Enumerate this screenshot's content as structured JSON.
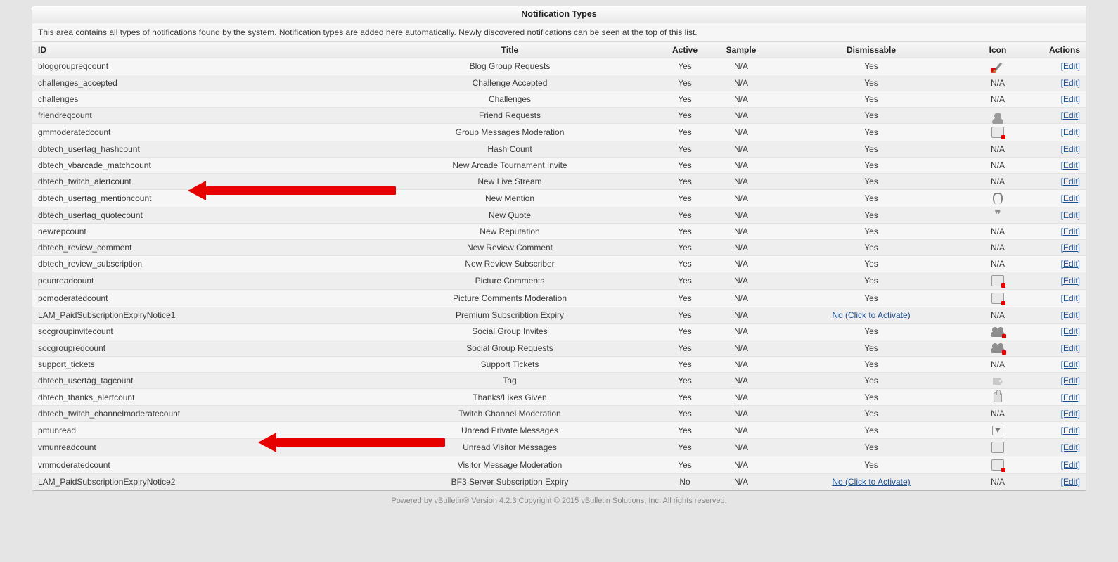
{
  "panel_title": "Notification Types",
  "description": "This area contains all types of notifications found by the system. Notification types are added here automatically. Newly discovered notifications can be seen at the top of this list.",
  "columns": {
    "id": "ID",
    "title": "Title",
    "active": "Active",
    "sample": "Sample",
    "dismissable": "Dismissable",
    "icon": "Icon",
    "actions": "Actions"
  },
  "edit_label": "[Edit]",
  "click_activate": "No (Click to Activate)",
  "footer": "Powered by vBulletin® Version 4.2.3 Copyright © 2015 vBulletin Solutions, Inc. All rights reserved.",
  "rows": [
    {
      "id": "bloggroupreqcount",
      "title": "Blog Group Requests",
      "active": "Yes",
      "sample": "N/A",
      "dismissable": "Yes",
      "icon": "pencil-red",
      "dismiss_link": false
    },
    {
      "id": "challenges_accepted",
      "title": "Challenge Accepted",
      "active": "Yes",
      "sample": "N/A",
      "dismissable": "Yes",
      "icon": "na",
      "dismiss_link": false
    },
    {
      "id": "challenges",
      "title": "Challenges",
      "active": "Yes",
      "sample": "N/A",
      "dismissable": "Yes",
      "icon": "na",
      "dismiss_link": false
    },
    {
      "id": "friendreqcount",
      "title": "Friend Requests",
      "active": "Yes",
      "sample": "N/A",
      "dismissable": "Yes",
      "icon": "person",
      "dismiss_link": false
    },
    {
      "id": "gmmoderatedcount",
      "title": "Group Messages Moderation",
      "active": "Yes",
      "sample": "N/A",
      "dismissable": "Yes",
      "icon": "box-red",
      "dismiss_link": false
    },
    {
      "id": "dbtech_usertag_hashcount",
      "title": "Hash Count",
      "active": "Yes",
      "sample": "N/A",
      "dismissable": "Yes",
      "icon": "na",
      "dismiss_link": false
    },
    {
      "id": "dbtech_vbarcade_matchcount",
      "title": "New Arcade Tournament Invite",
      "active": "Yes",
      "sample": "N/A",
      "dismissable": "Yes",
      "icon": "na",
      "dismiss_link": false
    },
    {
      "id": "dbtech_twitch_alertcount",
      "title": "New Live Stream",
      "active": "Yes",
      "sample": "N/A",
      "dismissable": "Yes",
      "icon": "na",
      "dismiss_link": false
    },
    {
      "id": "dbtech_usertag_mentioncount",
      "title": "New Mention",
      "active": "Yes",
      "sample": "N/A",
      "dismissable": "Yes",
      "icon": "clip",
      "dismiss_link": false
    },
    {
      "id": "dbtech_usertag_quotecount",
      "title": "New Quote",
      "active": "Yes",
      "sample": "N/A",
      "dismissable": "Yes",
      "icon": "quotes",
      "dismiss_link": false
    },
    {
      "id": "newrepcount",
      "title": "New Reputation",
      "active": "Yes",
      "sample": "N/A",
      "dismissable": "Yes",
      "icon": "na",
      "dismiss_link": false
    },
    {
      "id": "dbtech_review_comment",
      "title": "New Review Comment",
      "active": "Yes",
      "sample": "N/A",
      "dismissable": "Yes",
      "icon": "na",
      "dismiss_link": false
    },
    {
      "id": "dbtech_review_subscription",
      "title": "New Review Subscriber",
      "active": "Yes",
      "sample": "N/A",
      "dismissable": "Yes",
      "icon": "na",
      "dismiss_link": false
    },
    {
      "id": "pcunreadcount",
      "title": "Picture Comments",
      "active": "Yes",
      "sample": "N/A",
      "dismissable": "Yes",
      "icon": "box-red",
      "dismiss_link": false
    },
    {
      "id": "pcmoderatedcount",
      "title": "Picture Comments Moderation",
      "active": "Yes",
      "sample": "N/A",
      "dismissable": "Yes",
      "icon": "box-red",
      "dismiss_link": false
    },
    {
      "id": "LAM_PaidSubscriptionExpiryNotice1",
      "title": "Premium Subscribtion Expiry",
      "active": "Yes",
      "sample": "N/A",
      "dismissable": "__link__",
      "icon": "na",
      "dismiss_link": true
    },
    {
      "id": "socgroupinvitecount",
      "title": "Social Group Invites",
      "active": "Yes",
      "sample": "N/A",
      "dismissable": "Yes",
      "icon": "group-red",
      "dismiss_link": false
    },
    {
      "id": "socgroupreqcount",
      "title": "Social Group Requests",
      "active": "Yes",
      "sample": "N/A",
      "dismissable": "Yes",
      "icon": "group-red",
      "dismiss_link": false
    },
    {
      "id": "support_tickets",
      "title": "Support Tickets",
      "active": "Yes",
      "sample": "N/A",
      "dismissable": "Yes",
      "icon": "na",
      "dismiss_link": false
    },
    {
      "id": "dbtech_usertag_tagcount",
      "title": "Tag",
      "active": "Yes",
      "sample": "N/A",
      "dismissable": "Yes",
      "icon": "tag",
      "dismiss_link": false
    },
    {
      "id": "dbtech_thanks_alertcount",
      "title": "Thanks/Likes Given",
      "active": "Yes",
      "sample": "N/A",
      "dismissable": "Yes",
      "icon": "thumb",
      "dismiss_link": false
    },
    {
      "id": "dbtech_twitch_channelmoderatecount",
      "title": "Twitch Channel Moderation",
      "active": "Yes",
      "sample": "N/A",
      "dismissable": "Yes",
      "icon": "na",
      "dismiss_link": false
    },
    {
      "id": "pmunread",
      "title": "Unread Private Messages",
      "active": "Yes",
      "sample": "N/A",
      "dismissable": "Yes",
      "icon": "arrow-down",
      "dismiss_link": false
    },
    {
      "id": "vmunreadcount",
      "title": "Unread Visitor Messages",
      "active": "Yes",
      "sample": "N/A",
      "dismissable": "Yes",
      "icon": "box",
      "dismiss_link": false
    },
    {
      "id": "vmmoderatedcount",
      "title": "Visitor Message Moderation",
      "active": "Yes",
      "sample": "N/A",
      "dismissable": "Yes",
      "icon": "box-red",
      "dismiss_link": false
    },
    {
      "id": "LAM_PaidSubscriptionExpiryNotice2",
      "title": "BF3 Server Subscription Expiry",
      "active": "No",
      "sample": "N/A",
      "dismissable": "__link__",
      "icon": "na",
      "dismiss_link": true
    }
  ]
}
